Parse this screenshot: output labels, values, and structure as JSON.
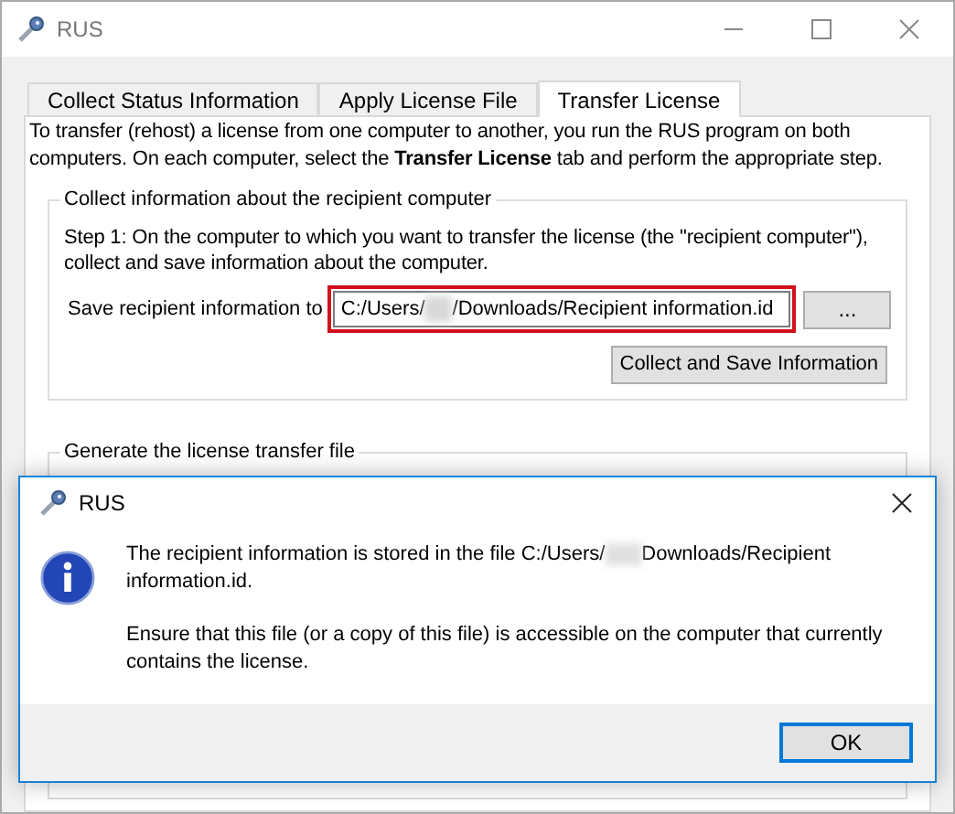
{
  "window": {
    "title": "RUS"
  },
  "tabs": [
    {
      "label": "Collect Status Information",
      "selected": false
    },
    {
      "label": "Apply License File",
      "selected": false
    },
    {
      "label": "Transfer License",
      "selected": true
    }
  ],
  "intro": "To transfer (rehost) a license from one computer to another, you run the RUS program on both computers. On each computer, select the **Transfer License** tab and perform the appropriate step.",
  "collect_group": {
    "title": "Collect information about the recipient computer",
    "step": "Step 1: On the computer to which you want to transfer the license (the \"recipient computer\"), collect and save information about the computer.",
    "field_label": "Save recipient information to",
    "path_before": "C:/Users/",
    "path_after": "/Downloads/Recipient information.id",
    "highlighted": true,
    "browse_button": "...",
    "collect_button": "Collect and Save Information"
  },
  "generate_group": {
    "title": "Generate the license transfer file"
  },
  "dialog": {
    "title": "RUS",
    "message_1_before": "The recipient information is stored in the file C:/Users/",
    "message_1_after": "Downloads/Recipient information.id.",
    "message_2": "Ensure that this file (or a copy of this file) is accessible on the computer that currently contains the license.",
    "ok_button": "OK"
  }
}
